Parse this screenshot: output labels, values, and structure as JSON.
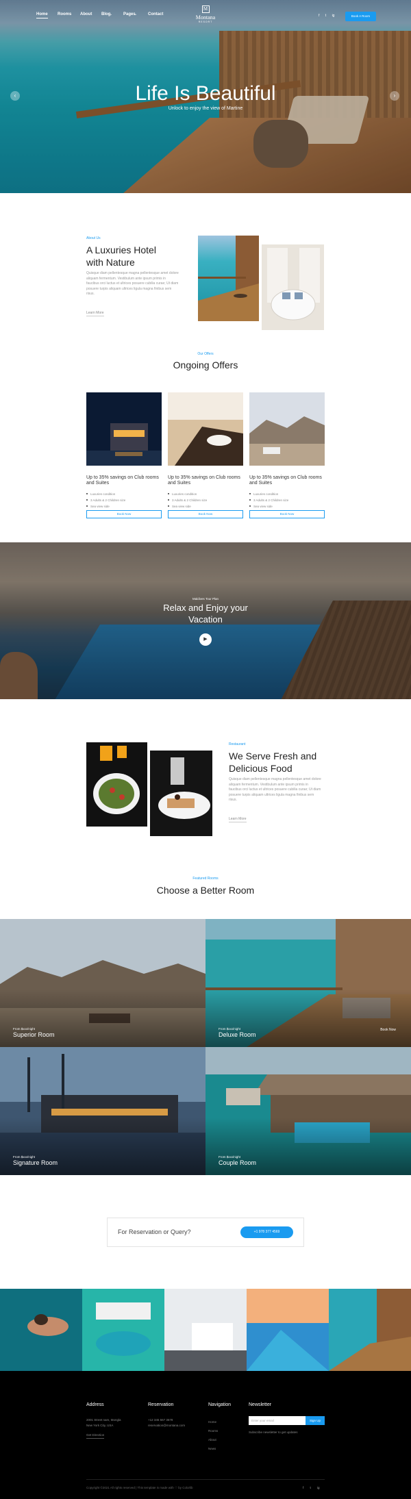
{
  "nav": {
    "items": [
      "Home",
      "Rooms",
      "About",
      "Blog",
      "Pages",
      "Contact"
    ],
    "logo_letter": "M",
    "logo_name": "Montana",
    "logo_sub": "RESORT",
    "socials": [
      "f",
      "t",
      "ig"
    ],
    "book_button": "Book A Room"
  },
  "hero": {
    "title": "Life Is Beautiful",
    "subtitle": "Unlock to enjoy the view of Martine",
    "prev_icon": "chevron-left-icon",
    "next_icon": "chevron-right-icon"
  },
  "about": {
    "eyebrow": "About Us",
    "title_line1": "A Luxuries Hotel",
    "title_line2": "with Nature",
    "text": "Quisque diam pellentesque magna pellentesque amet dolore aliquam fermentum. Vestibulum ante ipsum primis in faucibus orci luctus et ultrices posuere cubilia curae; Ut diam posuere turpis aliquam ultrices ligula magna finibus sem risus.",
    "link": "Learn More"
  },
  "offers": {
    "eyebrow": "Our Offers",
    "title": "Ongoing Offers",
    "cards": [
      {
        "title": "Up to 35% savings on Club rooms and Suites",
        "items": [
          "Luxuries condition",
          "3 Adults & 2 Children size",
          "Sea view side"
        ],
        "button": "Book Now"
      },
      {
        "title": "Up to 35% savings on Club rooms and Suites",
        "items": [
          "Luxuries condition",
          "3 Adults & 2 Children size",
          "Sea view side"
        ],
        "button": "Book Now"
      },
      {
        "title": "Up to 35% savings on Club rooms and Suites",
        "items": [
          "Luxuries condition",
          "3 Adults & 2 Children size",
          "Sea view side"
        ],
        "button": "Book Now"
      }
    ]
  },
  "video": {
    "eyebrow": "Maldives Tour Plan",
    "title_line1": "Relax and Enjoy your",
    "title_line2": "Vacation",
    "play_icon": "play-icon"
  },
  "food": {
    "eyebrow": "Restaurant",
    "title_line1": "We Serve Fresh and",
    "title_line2": "Delicious Food",
    "text": "Quisque diam pellentesque magna pellentesque amet dolore aliquam fermentum. Vestibulum ante ipsum primis in faucibus orci luctus et ultrices posuere cubilia curae; Ut diam posuere turpis aliquam ultrices ligula magna finibus sem risus.",
    "link": "Learn More"
  },
  "rooms": {
    "eyebrow": "Featured Rooms",
    "title": "Choose a Better Room",
    "items": [
      {
        "from": "From $xxx/night",
        "name": "Superior Room"
      },
      {
        "from": "From $xxx/night",
        "name": "Deluxe Room",
        "action": "Book Now"
      },
      {
        "from": "From $xxx/night",
        "name": "Signature Room"
      },
      {
        "from": "From $xxx/night",
        "name": "Couple Room"
      }
    ]
  },
  "reservation": {
    "question": "For Reservation or Query?",
    "phone": "+1 978 377 4569"
  },
  "footer": {
    "address_title": "Address",
    "address_lines": [
      "2001 Street nam, Mongla",
      "New York City, USA"
    ],
    "address_link": "Get Direction",
    "reservation_title": "Reservation",
    "reservation_lines": [
      "+12 345 567 3678",
      "reservation@montana.com"
    ],
    "navigation_title": "Navigation",
    "navigation_links": [
      "Home",
      "Rooms",
      "About",
      "News"
    ],
    "newsletter_title": "Newsletter",
    "newsletter_placeholder": "Enter your email",
    "newsletter_button": "Sign Up",
    "newsletter_note": "Subscribe newsletter to get updates",
    "copyright": "Copyright ©2021 All rights reserved | This template is made with ♡ by Colorlib",
    "socials": [
      "f",
      "t",
      "ig"
    ]
  },
  "colors": {
    "accent": "#1a9bf0",
    "footer_bg": "#000000"
  }
}
